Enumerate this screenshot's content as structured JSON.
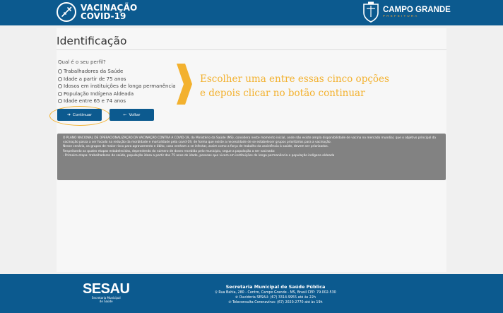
{
  "header": {
    "logo_line1": "VACINAÇÃO",
    "logo_line2": "COVID-19",
    "city_name": "CAMPO GRANDE",
    "city_sub": "PREFEITURA"
  },
  "page": {
    "title": "Identificação",
    "question": "Qual é o seu perfil?"
  },
  "options": [
    {
      "label": "Trabalhadores da Saúde"
    },
    {
      "label": "Idade a partir de 75 anos"
    },
    {
      "label": "Idosos em instituições de longa permanência"
    },
    {
      "label": "População Indígena Aldeada"
    },
    {
      "label": "Idade entre 65 e 74 anos"
    }
  ],
  "buttons": {
    "continue_label": "Continuar",
    "back_label": "Voltar"
  },
  "annotation": {
    "line1": "Escolher uma entre essas cinco opções",
    "line2": "e depois clicar no botão continuar"
  },
  "notice": {
    "p1": "O PLANO NACIONAL DE OPERACIONALIZAÇÃO DA VACINAÇÃO CONTRA A COVID-19, do Ministério da Saúde (MS), considera neste momento inicial, onde não existe ampla disponibilidade de vacina no mercado mundial, que o objetivo principal da vacinação passa a ser focado na redução da morbidade e mortalidade pela covid-19, de forma que existe a necessidade de se estabelecer grupos prioritários para a vacinação.",
    "p2": "Nesse cenário, os grupos de maior risco para agravamento e óbito, caso venham a se infectar, assim como a força de trabalho da assistência à saúde, devem ser priorizados.",
    "p3": "Respeitando as quatro etapas estabelecidas, dependendo do número de doses recebida pelo município, segue a população a ser vacinada:",
    "p4": "- Primeira etapa: trabalhadores de saúde, população idosa a partir dos 75 anos de idade, pessoas que vivem em instituições de longa permanência e população indígena aldeada"
  },
  "footer": {
    "brand": "SESAU",
    "brand_sub1": "Secretaria Municipal",
    "brand_sub2": "de Saúde",
    "org": "Secretaria Municipal de Saúde Pública",
    "address": "Rua Bahia, 280 - Centro, Campo Grande - MS, Brasil CEP: 79.002-530",
    "ouvidoria": "Ouvidoria SESAU: (67) 3314-9955 até às 22h",
    "teleconsulta": "Teleconsulta Coronavírus: (67) 2020-2770 até às 19h"
  },
  "colors": {
    "primary": "#0c5a8f",
    "accent": "#f3b12e",
    "notice_bg": "#828282"
  }
}
